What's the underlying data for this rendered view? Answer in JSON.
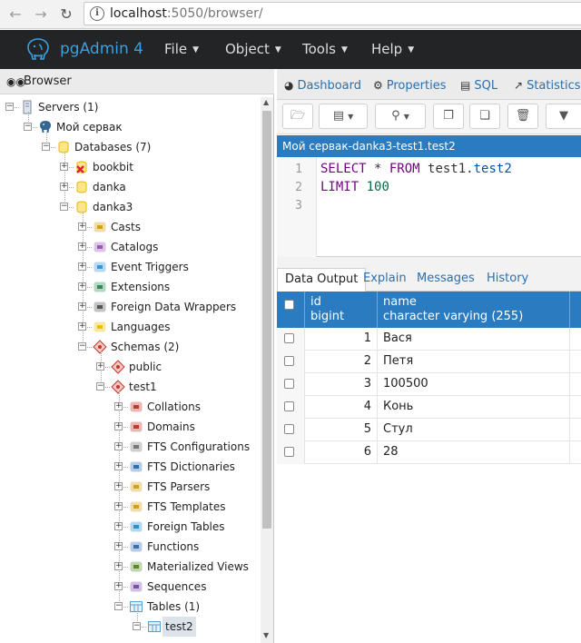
{
  "browser": {
    "url_host": "localhost",
    "url_rest": ":5050/browser/"
  },
  "app": {
    "title": "pgAdmin 4",
    "menus": [
      "File",
      "Object",
      "Tools",
      "Help"
    ]
  },
  "browser_panel": {
    "title": "Browser",
    "tree": [
      {
        "label": "Servers (1)",
        "level": 0,
        "icon": "server-group-icon",
        "toggle": "-"
      },
      {
        "label": "Мой сервак",
        "level": 1,
        "icon": "elephant-icon",
        "toggle": "-"
      },
      {
        "label": "Databases (7)",
        "level": 2,
        "icon": "databases-icon",
        "toggle": "-"
      },
      {
        "label": "bookbit",
        "level": 3,
        "icon": "database-disconnected-icon",
        "toggle": "+"
      },
      {
        "label": "danka",
        "level": 3,
        "icon": "database-icon",
        "toggle": "+"
      },
      {
        "label": "danka3",
        "level": 3,
        "icon": "database-icon",
        "toggle": "-"
      },
      {
        "label": "Casts",
        "level": 4,
        "icon": "casts-icon",
        "toggle": "+"
      },
      {
        "label": "Catalogs",
        "level": 4,
        "icon": "catalogs-icon",
        "toggle": "+"
      },
      {
        "label": "Event Triggers",
        "level": 4,
        "icon": "event-triggers-icon",
        "toggle": "+"
      },
      {
        "label": "Extensions",
        "level": 4,
        "icon": "extensions-icon",
        "toggle": "+"
      },
      {
        "label": "Foreign Data Wrappers",
        "level": 4,
        "icon": "fdw-icon",
        "toggle": "+"
      },
      {
        "label": "Languages",
        "level": 4,
        "icon": "languages-icon",
        "toggle": "+"
      },
      {
        "label": "Schemas (2)",
        "level": 4,
        "icon": "schemas-icon",
        "toggle": "-"
      },
      {
        "label": "public",
        "level": 5,
        "icon": "schema-icon",
        "toggle": "+"
      },
      {
        "label": "test1",
        "level": 5,
        "icon": "schema-icon",
        "toggle": "-"
      },
      {
        "label": "Collations",
        "level": 6,
        "icon": "collations-icon",
        "toggle": "+"
      },
      {
        "label": "Domains",
        "level": 6,
        "icon": "domains-icon",
        "toggle": "+"
      },
      {
        "label": "FTS Configurations",
        "level": 6,
        "icon": "fts-config-icon",
        "toggle": "+"
      },
      {
        "label": "FTS Dictionaries",
        "level": 6,
        "icon": "fts-dict-icon",
        "toggle": "+"
      },
      {
        "label": "FTS Parsers",
        "level": 6,
        "icon": "fts-parser-icon",
        "toggle": "+"
      },
      {
        "label": "FTS Templates",
        "level": 6,
        "icon": "fts-template-icon",
        "toggle": "+"
      },
      {
        "label": "Foreign Tables",
        "level": 6,
        "icon": "foreign-tables-icon",
        "toggle": "+"
      },
      {
        "label": "Functions",
        "level": 6,
        "icon": "functions-icon",
        "toggle": "+"
      },
      {
        "label": "Materialized Views",
        "level": 6,
        "icon": "mviews-icon",
        "toggle": "+"
      },
      {
        "label": "Sequences",
        "level": 6,
        "icon": "sequences-icon",
        "toggle": "+"
      },
      {
        "label": "Tables (1)",
        "level": 6,
        "icon": "tables-icon",
        "toggle": "-"
      },
      {
        "label": "test2",
        "level": 7,
        "icon": "table-icon",
        "toggle": "-",
        "selected": true
      }
    ]
  },
  "tabs": [
    {
      "label": "Dashboard",
      "icon": "dashboard-icon"
    },
    {
      "label": "Properties",
      "icon": "properties-icon"
    },
    {
      "label": "SQL",
      "icon": "sql-icon"
    },
    {
      "label": "Statistics",
      "icon": "statistics-icon"
    }
  ],
  "query": {
    "title": "Мой сервак-danka3-test1.test2",
    "line_numbers": [
      "1",
      "2",
      "3"
    ],
    "line1": {
      "kw1": "SELECT",
      "star": " * ",
      "kw2": "FROM",
      "schema": " test1.",
      "table": "test2"
    },
    "line2": {
      "kw": "LIMIT",
      "num": " 100"
    }
  },
  "output": {
    "tabs": [
      "Data Output",
      "Explain",
      "Messages",
      "History"
    ],
    "columns": [
      {
        "name": "id",
        "type": "bigint"
      },
      {
        "name": "name",
        "type": "character varying (255)"
      }
    ],
    "rows": [
      {
        "id": "1",
        "name": "Вася"
      },
      {
        "id": "2",
        "name": "Петя"
      },
      {
        "id": "3",
        "name": "100500"
      },
      {
        "id": "4",
        "name": "Конь"
      },
      {
        "id": "5",
        "name": "Стул"
      },
      {
        "id": "6",
        "name": "28"
      }
    ]
  }
}
